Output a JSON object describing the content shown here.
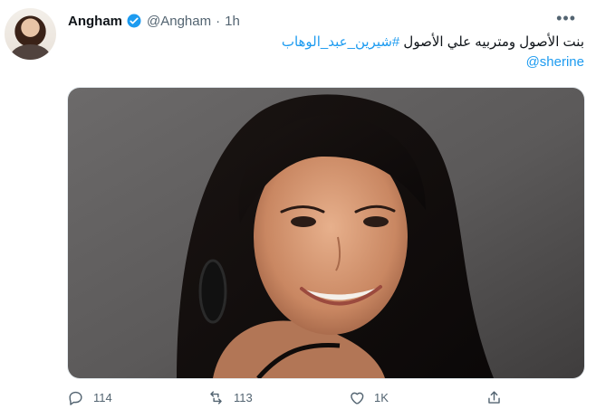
{
  "tweet": {
    "author_name": "Angham",
    "handle": "@Angham",
    "separator": "·",
    "time": "1h",
    "text": "بنت الأصول ومتربيه علي الأصول ",
    "hashtag": "#شيرين_عبد_الوهاب",
    "mention": "@sherine",
    "more_label": "•••",
    "stats": {
      "replies": "114",
      "retweets": "113",
      "likes": "1K"
    }
  },
  "colors": {
    "accent": "#1d9bf0",
    "muted": "#536471",
    "text": "#0f1419"
  },
  "icons": [
    "verified-badge-icon",
    "more-icon",
    "reply-icon",
    "retweet-icon",
    "like-icon",
    "share-icon"
  ]
}
